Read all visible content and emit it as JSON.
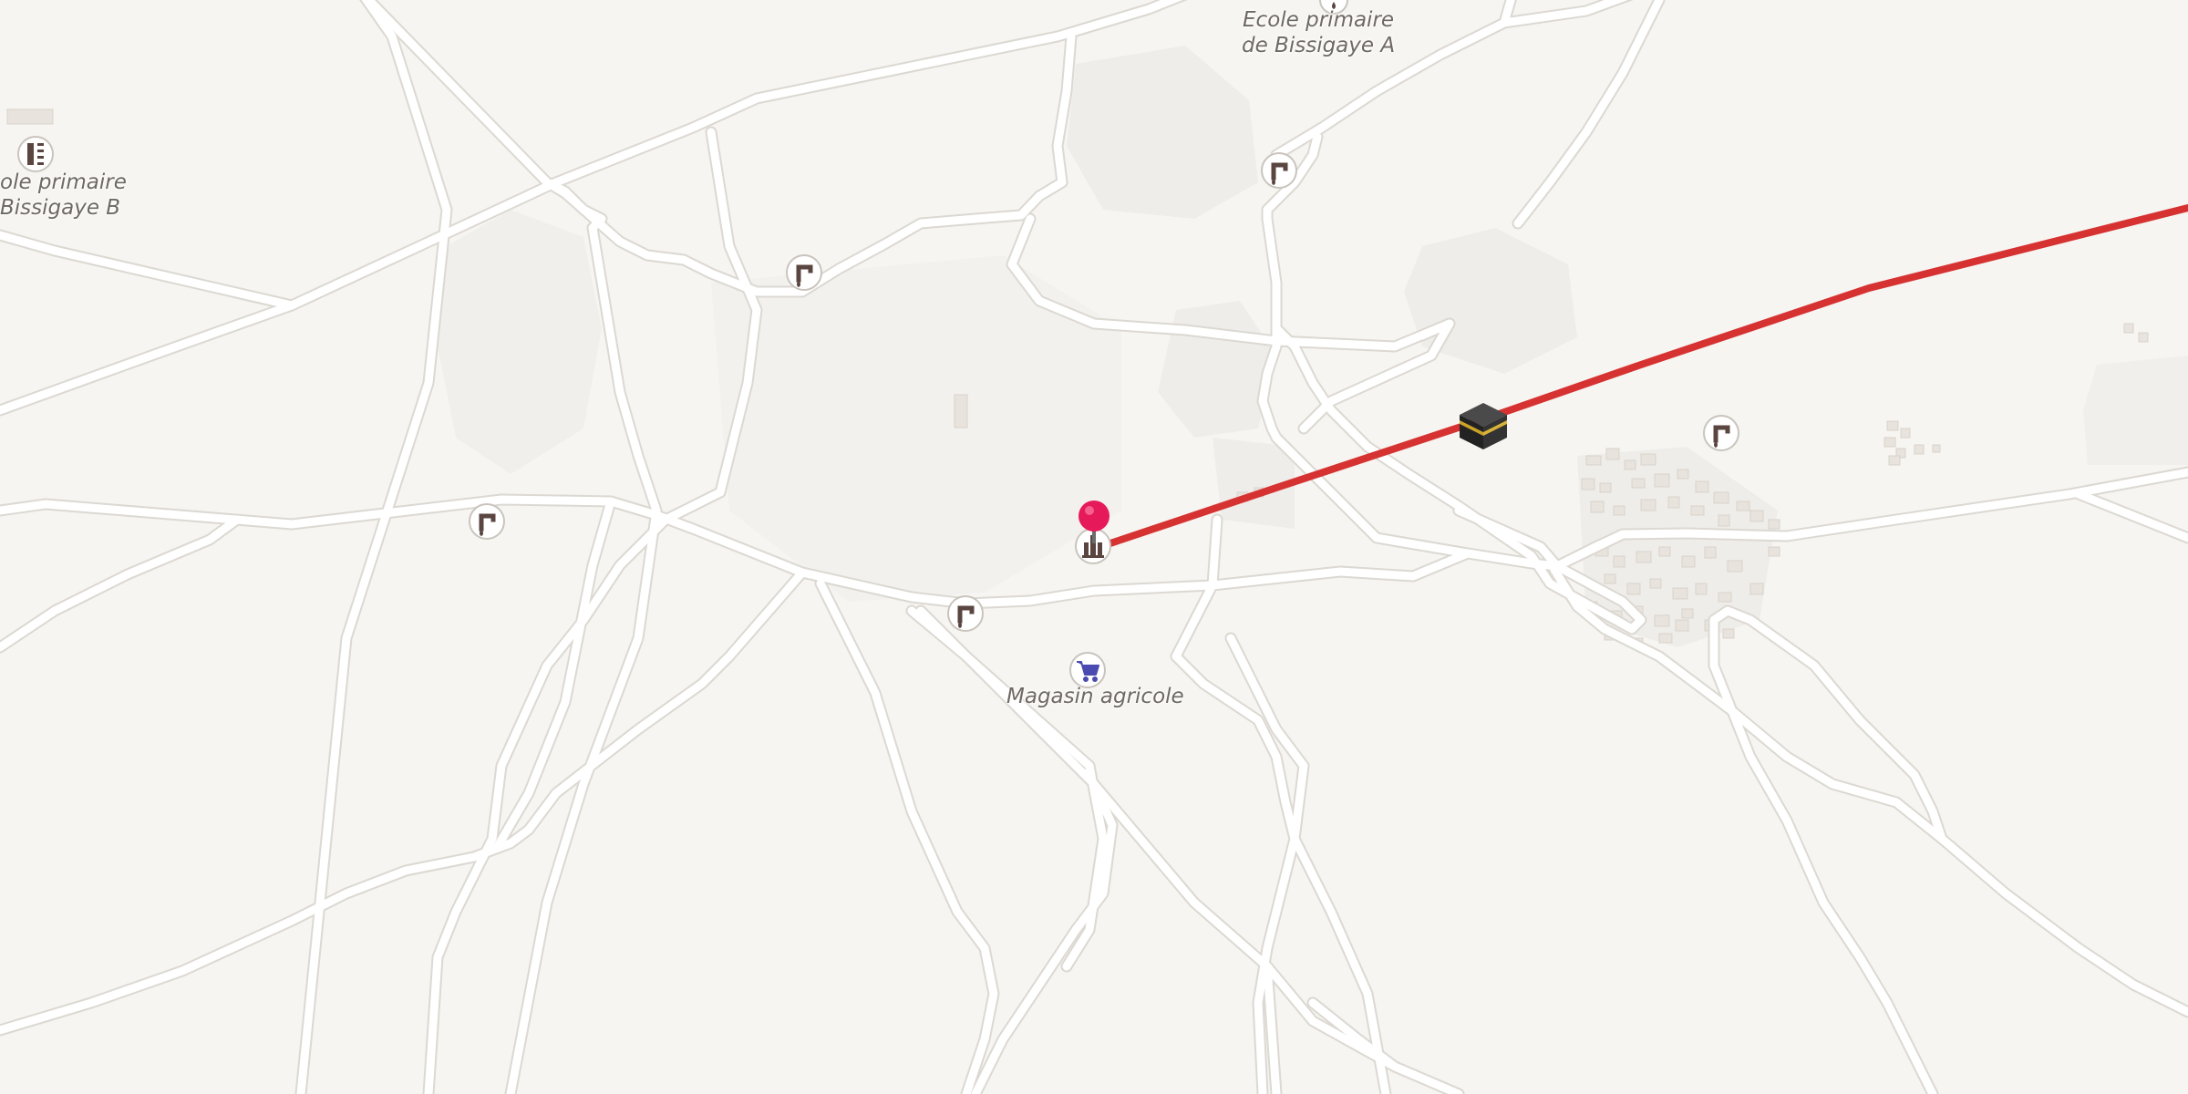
{
  "map": {
    "labels": {
      "school_a_line1": "Ecole primaire",
      "school_a_line2": "de Bissigaye A",
      "school_b_line1": "ole primaire",
      "school_b_line2": "Bissigaye B",
      "shop": "Magasin agricole"
    },
    "route": {
      "color": "#d63232"
    },
    "colors": {
      "background": "#f7f5f1",
      "road": "#ffffff",
      "road_casing": "#dcd8d2",
      "pin": "#e6195a",
      "tap_icon": "#5a4540",
      "shop_icon": "#4a4ab0"
    },
    "icons": [
      "water-tap-icon",
      "school-icon",
      "supermarket-cart-icon",
      "kaaba-mosque-icon",
      "monument-icon",
      "location-pin-icon"
    ]
  }
}
